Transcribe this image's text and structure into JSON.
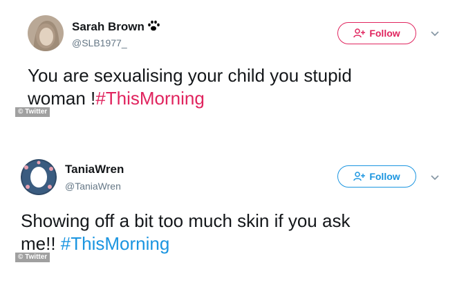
{
  "tweets": [
    {
      "name": "Sarah Brown",
      "handle": "@SLB1977_",
      "follow_label": "Follow",
      "text": "You are sexualising your child you stupid",
      "text_line2_plain": "woman !",
      "hashtag": "#ThisMorning",
      "accent_color": "#e0245e",
      "credit": "© Twitter"
    },
    {
      "name": "TaniaWren",
      "handle": "@TaniaWren",
      "follow_label": "Follow",
      "text": "Showing off a bit too much skin if you ask",
      "text_line2_plain": "me!! ",
      "hashtag": "#ThisMorning",
      "accent_color": "#1b95e0",
      "credit": "© Twitter"
    }
  ]
}
